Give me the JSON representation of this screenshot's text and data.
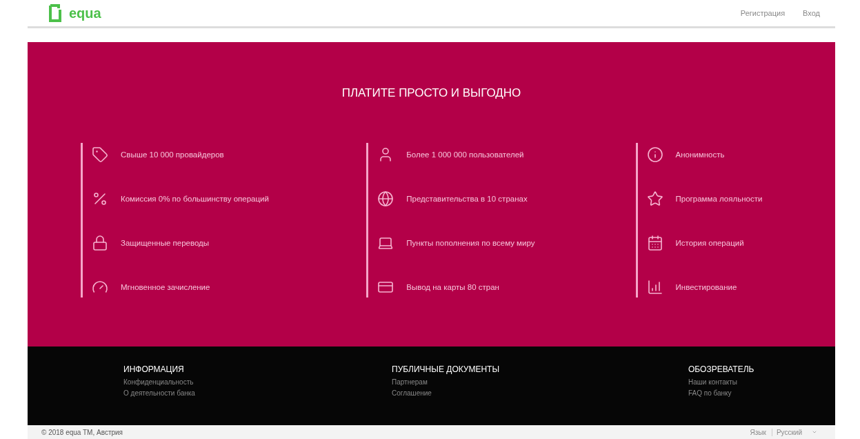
{
  "header": {
    "logo": "equa",
    "nav": [
      "Регистрация",
      "Вход"
    ]
  },
  "hero": {
    "title": "ПЛАТИТЕ ПРОСТО И ВЫГОДНО",
    "columns": [
      {
        "items": [
          "Свыше 10 000 провайдеров",
          "Комиссия 0% по большинству операций",
          "Защищенные переводы",
          "Мгновенное зачисление"
        ]
      },
      {
        "items": [
          "Более 1 000 000 пользователей",
          "Представительства в 10 странах",
          "Пункты пополнения по всему миру",
          "Вывод на карты 80 стран"
        ]
      },
      {
        "items": [
          "Анонимность",
          "Программа лояльности",
          "История операций",
          "Инвестирование"
        ]
      }
    ]
  },
  "footer": {
    "columns": [
      {
        "heading": "ИНФОРМАЦИЯ",
        "links": [
          "Конфиденциальность",
          "О деятельности банка"
        ]
      },
      {
        "heading": "ПУБЛИЧНЫЕ ДОКУМЕНТЫ",
        "links": [
          "Партнерам",
          "Соглашение"
        ]
      },
      {
        "heading": "ОБОЗРЕВАТЕЛЬ",
        "links": [
          "Наши контакты",
          "FAQ по банку"
        ]
      }
    ]
  },
  "bottom_bar": {
    "copyright": "© 2018 equa TM, Австрия",
    "language_label": "Язык",
    "language": "Русский"
  }
}
